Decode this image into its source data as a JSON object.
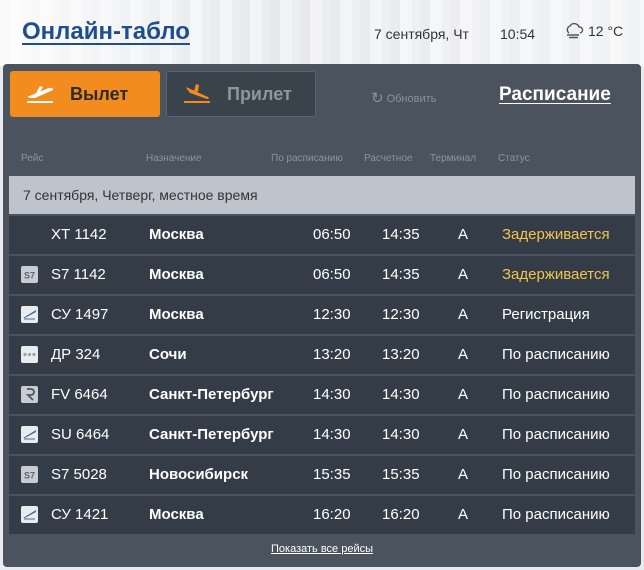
{
  "header": {
    "title": "Онлайн-табло",
    "date": "7 сентября, Чт",
    "time": "10:54",
    "temperature": "12 °C"
  },
  "tabs": {
    "departure": "Вылет",
    "arrival": "Прилет"
  },
  "refresh_label": "Обновить",
  "schedule_link": "Расписание",
  "columns": {
    "flight": "Рейс",
    "destination": "Назначение",
    "scheduled": "По расписанию",
    "estimated": "Расчетное",
    "terminal": "Терминал",
    "status": "Статус"
  },
  "date_bar": "7 сентября, Четверг, местное время",
  "flights": [
    {
      "logo": "none",
      "flight": "ХТ 1142",
      "destination": "Москва",
      "scheduled": "06:50",
      "estimated": "14:35",
      "terminal": "A",
      "status": "Задерживается"
    },
    {
      "logo": "s7-icon",
      "flight": "S7 1142",
      "destination": "Москва",
      "scheduled": "06:50",
      "estimated": "14:35",
      "terminal": "A",
      "status": "Задерживается"
    },
    {
      "logo": "aeroflot-icon",
      "flight": "СУ 1497",
      "destination": "Москва",
      "scheduled": "12:30",
      "estimated": "12:30",
      "terminal": "A",
      "status": "Регистрация"
    },
    {
      "logo": "dots-icon",
      "flight": "ДР 324",
      "destination": "Сочи",
      "scheduled": "13:20",
      "estimated": "13:20",
      "terminal": "A",
      "status": "По расписанию"
    },
    {
      "logo": "rossiya-icon",
      "flight": "FV 6464",
      "destination": "Санкт-Петербург",
      "scheduled": "14:30",
      "estimated": "14:30",
      "terminal": "A",
      "status": "По расписанию"
    },
    {
      "logo": "aeroflot-icon",
      "flight": "SU 6464",
      "destination": "Санкт-Петербург",
      "scheduled": "14:30",
      "estimated": "14:30",
      "terminal": "A",
      "status": "По расписанию"
    },
    {
      "logo": "s7-icon",
      "flight": "S7 5028",
      "destination": "Новосибирск",
      "scheduled": "15:35",
      "estimated": "15:35",
      "terminal": "A",
      "status": "По расписанию"
    },
    {
      "logo": "aeroflot-icon",
      "flight": "СУ 1421",
      "destination": "Москва",
      "scheduled": "16:20",
      "estimated": "16:20",
      "terminal": "A",
      "status": "По расписанию"
    }
  ],
  "footer_link": "Показать все рейсы",
  "colors": {
    "accent": "#f28c1e",
    "board": "#4a535e",
    "row": "#343c47",
    "delayed": "#f2c44a",
    "title": "#1f4e8c"
  }
}
